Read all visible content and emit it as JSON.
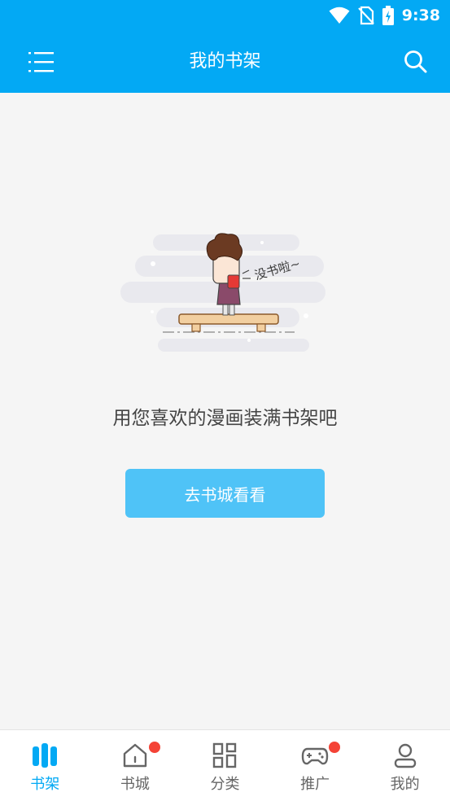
{
  "status_bar": {
    "time": "9:38",
    "icons": [
      "wifi-icon",
      "no-sim-icon",
      "battery-charging-icon"
    ]
  },
  "app_bar": {
    "title": "我的书架",
    "menu_icon": "menu-icon",
    "search_icon": "search-icon",
    "background": "#03a9f4"
  },
  "empty_state": {
    "illustration_caption": "没书啦~",
    "message": "用您喜欢的漫画装满书架吧",
    "button_label": "去书城看看",
    "button_color": "#4fc3f7"
  },
  "bottom_nav": {
    "active_color": "#03a9f4",
    "badge_color": "#f44336",
    "items": [
      {
        "label": "书架",
        "icon": "bookshelf-icon",
        "active": true,
        "badge": false
      },
      {
        "label": "书城",
        "icon": "home-icon",
        "active": false,
        "badge": true
      },
      {
        "label": "分类",
        "icon": "category-grid-icon",
        "active": false,
        "badge": false
      },
      {
        "label": "推广",
        "icon": "gamepad-icon",
        "active": false,
        "badge": true
      },
      {
        "label": "我的",
        "icon": "profile-icon",
        "active": false,
        "badge": false
      }
    ]
  }
}
